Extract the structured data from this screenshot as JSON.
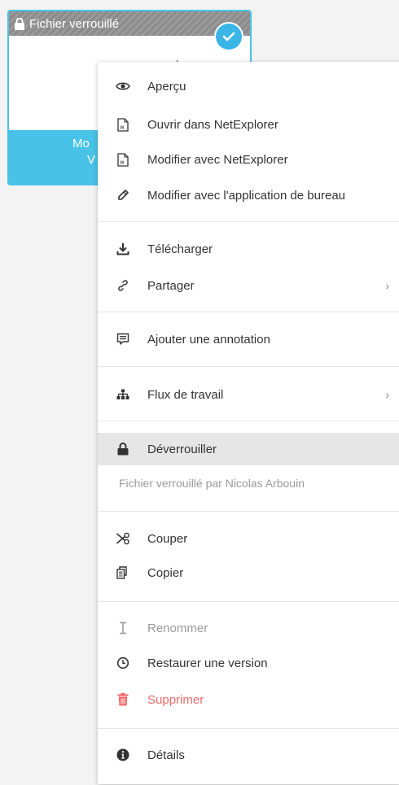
{
  "tile": {
    "header_label": "Fichier verrouillé",
    "bottom_line1": "Mo",
    "bottom_line2": "V",
    "accent": "#49c2e8"
  },
  "menu": {
    "items": [
      {
        "label": "Aperçu",
        "icon": "eye-icon"
      },
      {
        "label": "Ouvrir dans NetExplorer",
        "icon": "word-doc-icon"
      },
      {
        "label": "Modifier avec NetExplorer",
        "icon": "word-doc-icon"
      },
      {
        "label": "Modifier avec l'application de bureau",
        "icon": "pencil-icon"
      },
      {
        "label": "Télécharger",
        "icon": "download-icon"
      },
      {
        "label": "Partager",
        "icon": "share-icon",
        "submenu": true
      },
      {
        "label": "Ajouter une annotation",
        "icon": "comment-icon"
      },
      {
        "label": "Flux de travail",
        "icon": "workflow-icon",
        "submenu": true
      },
      {
        "label": "Déverrouiller",
        "icon": "unlock-icon",
        "highlighted": true
      },
      {
        "label": "Couper",
        "icon": "scissors-icon"
      },
      {
        "label": "Copier",
        "icon": "copy-icon"
      },
      {
        "label": "Renommer",
        "icon": "text-cursor-icon",
        "disabled": true
      },
      {
        "label": "Restaurer une version",
        "icon": "history-icon"
      },
      {
        "label": "Supprimer",
        "icon": "trash-icon",
        "danger": true
      },
      {
        "label": "Détails",
        "icon": "info-icon"
      }
    ],
    "locked_by": "Fichier verrouillé par Nicolas Arbouin",
    "submenu_glyph": "›",
    "colors": {
      "danger": "#f06a6a",
      "disabled": "#9a9a9a",
      "hover": "#e6e6e6"
    }
  }
}
